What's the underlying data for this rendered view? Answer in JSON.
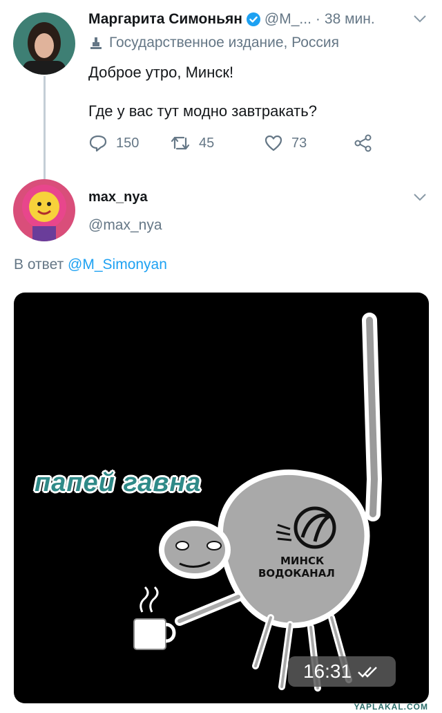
{
  "tweet": {
    "author_name": "Маргарита Симоньян",
    "handle": "@M_...",
    "dot": "·",
    "time": "38 мин.",
    "label": "Государственное издание, Россия",
    "line1": "Доброе утро, Минск!",
    "line2": "Где у вас тут модно завтракать?",
    "replies": "150",
    "retweets": "45",
    "likes": "73"
  },
  "reply": {
    "author_name": "max_nya",
    "handle": "@max_nya",
    "reply_prefix": "В ответ",
    "mention": "@M_Simonyan"
  },
  "media": {
    "caption": "папей гавна",
    "logo_line1": "МИНСК",
    "logo_line2": "ВОДОКАНАЛ",
    "time": "16:31",
    "watermark": "YAPLAKAL.COM"
  },
  "icons": [
    "verified-icon",
    "state-media-icon",
    "chevron-down-icon",
    "reply-icon",
    "retweet-icon",
    "like-icon",
    "share-icon",
    "double-check-icon"
  ],
  "colors": {
    "link": "#1da1f2",
    "verified": "#1da1f2",
    "muted": "#657786",
    "caption": "#2f8a88"
  }
}
